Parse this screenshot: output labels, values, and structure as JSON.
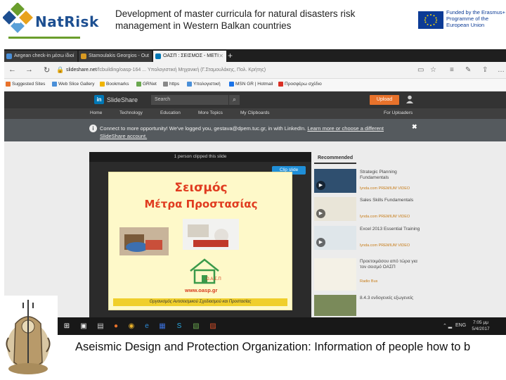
{
  "header": {
    "logo_text": "NatRisk",
    "title": "Development of master curricula for natural disasters risk management in Western Balkan countries",
    "eu_notice": "Funded by the Erasmus+ Programme of the European Union"
  },
  "browser": {
    "tabs": [
      {
        "label": "Aegean check-in μέσω ίδιοί",
        "active": false,
        "color": "#4a8fd8"
      },
      {
        "label": "Stamoulakis Georgios - Out",
        "active": false,
        "color": "#d89a22"
      },
      {
        "label": "ΟΑΣΠ : ΣΕΙΣΜΟΣ - ΜΕΤΙ",
        "active": true,
        "color": "#0077b5"
      }
    ],
    "url_host": "slideshare.net",
    "url_rest": "/fcbuilding/oasp-164 ... Υπολογιστική Μηχανική (Γ.Σταμουλάκης, Πολ. Κρήτης)",
    "favorites": [
      {
        "label": "Suggested Sites",
        "color": "#e8722b"
      },
      {
        "label": "Web Slice Gallery",
        "color": "#4a8fd8"
      },
      {
        "label": "Bookmarks",
        "color": "#f0b400"
      },
      {
        "label": "GRNet",
        "color": "#6aa84f"
      },
      {
        "label": "https",
        "color": "#888888"
      },
      {
        "label": "Υπολογιστική",
        "color": "#4a8fd8"
      },
      {
        "label": "MSN GR | Hotmail",
        "color": "#1a73e8"
      },
      {
        "label": "Προσφέρω σχέδιο",
        "color": "#d93025"
      }
    ]
  },
  "slideshare": {
    "brand": "SlideShare",
    "search_placeholder": "Search",
    "upload_label": "Upload",
    "nav": [
      "Home",
      "Technology",
      "Education",
      "More Topics",
      "My Clipboards",
      "For Uploaders"
    ],
    "notice_text": "Connect to more opportunity! We've logged you, gestava@dpem.tuc.gr, in with LinkedIn. ",
    "notice_link": "Learn more or choose a different SlideShare account.",
    "player_bar": "1 person clipped this slide",
    "clip_label": "Clip slide",
    "slide": {
      "title_1": "Σεισμός",
      "title_2": "Μέτρα Προστασίας",
      "org_abbr": "Ο.Α.Σ.Π",
      "website": "www.oasp.gr",
      "footer": "Οργανισμός Αντισεισμικού Σχεδιασμού και Προστασίας"
    },
    "recommended_label": "Recommended",
    "recommended": [
      {
        "title": "Strategic Planning Fundamentals",
        "source": "lynda.com PREMIUM VIDEO",
        "thumb": "#2f4f6f"
      },
      {
        "title": "Sales Skills Fundamentals",
        "source": "lynda.com PREMIUM VIDEO",
        "thumb": "#e9e5d8"
      },
      {
        "title": "Excel 2013 Essential Training",
        "source": "lynda.com PREMIUM VIDEO",
        "thumb": "#dfe6ea"
      },
      {
        "title": "Προετοιμάσου από τώρα για τον σεισμό ΟΑΣΠ",
        "source": "Radio Bus",
        "thumb": "#f4f1e6"
      },
      {
        "title": "8.4.3 ενδογενείς εξωγενείς",
        "source": "",
        "thumb": "#7a8a5a"
      }
    ]
  },
  "taskbar": {
    "lang": "ENG",
    "time": "7:05 μμ",
    "date": "5/4/2017"
  },
  "caption": "Aseismic Design and Protection Organization: Information of people how to b"
}
